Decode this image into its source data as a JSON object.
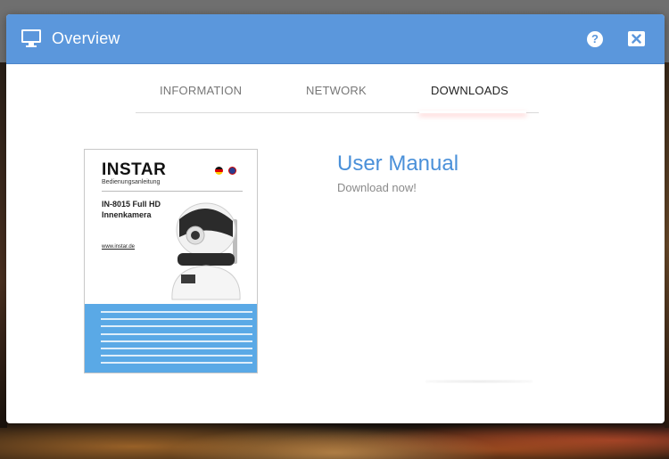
{
  "dialog": {
    "title": "Overview",
    "monitor_icon": "monitor-icon",
    "help_label": "?",
    "close_icon": "close-icon",
    "header_color": "#5b97dc"
  },
  "tabs": [
    {
      "label": "INFORMATION",
      "active": false
    },
    {
      "label": "NETWORK",
      "active": false
    },
    {
      "label": "DOWNLOADS",
      "active": true
    }
  ],
  "download": {
    "title": "User Manual",
    "subtitle": "Download now!",
    "accent_color": "#4a90d9",
    "cover": {
      "brand": "INSTAR",
      "brand_sub": "Bedienungsanleitung",
      "model_line1": "IN-8015 Full HD",
      "model_line2": "Innenkamera",
      "url": "www.instar.de",
      "flags": [
        "de-flag-icon",
        "uk-flag-icon"
      ],
      "band_color": "#5aa9e6"
    }
  }
}
